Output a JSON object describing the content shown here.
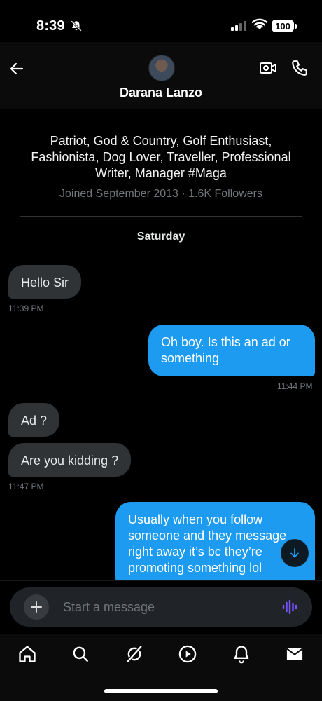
{
  "status_bar": {
    "time": "8:39",
    "battery": "100"
  },
  "header": {
    "contact_name": "Darana Lanzo"
  },
  "profile": {
    "bio": "Patriot, God & Country, Golf Enthusiast, Fashionista, Dog Lover, Traveller, Professional Writer, Manager #Maga",
    "joined": "Joined September 2013 · 1.6K Followers"
  },
  "day_separator": "Saturday",
  "messages": [
    {
      "direction": "in",
      "text": "Hello Sir",
      "time": "11:39 PM"
    },
    {
      "direction": "out",
      "text": "Oh boy. Is this an ad or something",
      "time": "11:44 PM"
    },
    {
      "direction": "in",
      "text": "Ad ?",
      "time": ""
    },
    {
      "direction": "in",
      "text": "Are you kidding ?",
      "time": "11:47 PM"
    },
    {
      "direction": "out",
      "text": "Usually when you follow someone and they message right away it’s bc  they’re promoting something  lol",
      "time": ""
    }
  ],
  "composer": {
    "placeholder": "Start a message"
  },
  "colors": {
    "accent": "#1d9bf0",
    "incoming_bubble": "#2f3336",
    "background": "#000000",
    "muted_text": "#71767b"
  },
  "nav": {
    "icons": [
      "home-icon",
      "search-icon",
      "grok-icon",
      "play-icon",
      "bell-icon",
      "mail-icon"
    ],
    "active": "mail-icon"
  }
}
